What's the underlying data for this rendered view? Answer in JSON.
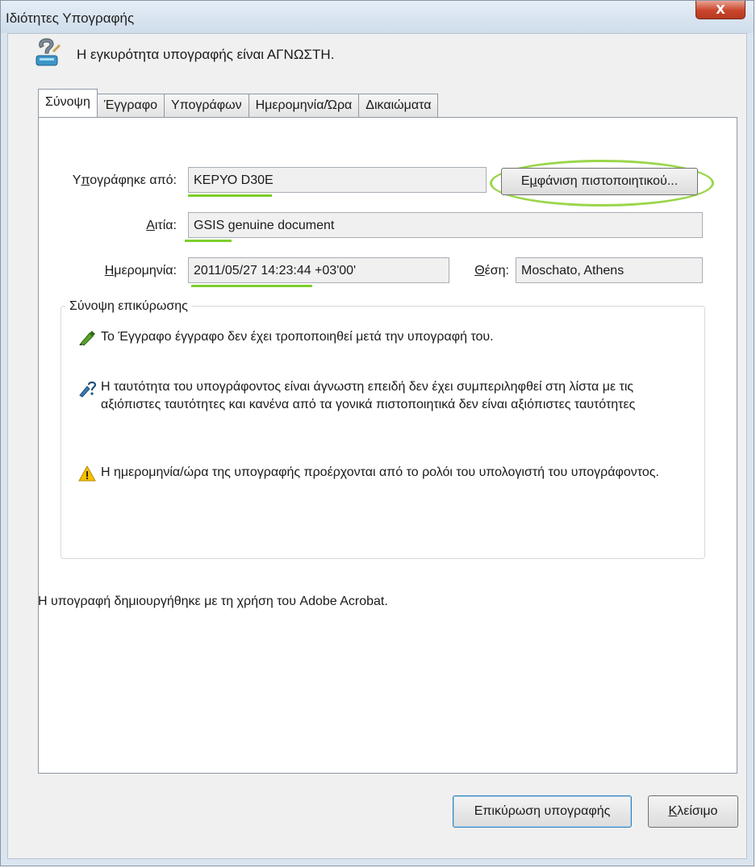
{
  "window": {
    "title": "Ιδιότητες Υπογραφής",
    "close_glyph": "X"
  },
  "status": {
    "text": "Η εγκυρότητα υπογραφής είναι ΑΓΝΩΣΤΗ.",
    "icon": "signature-unknown-icon"
  },
  "tabs": [
    {
      "label": "Σύνοψη",
      "active": true
    },
    {
      "label": "Έγγραφο",
      "active": false
    },
    {
      "label": "Υπογράφων",
      "active": false
    },
    {
      "label": "Ημερομηνία/Ώρα",
      "active": false
    },
    {
      "label": "Δικαιώματα",
      "active": false
    }
  ],
  "summary": {
    "signed_by": {
      "label_pre": "Υ",
      "label_mnemonic": "π",
      "label_post": "ογράφηκε από:",
      "value": "ΚΕΡΥΟ D30E"
    },
    "reason": {
      "label_mnemonic": "Α",
      "label_post": "ιτία:",
      "value": "GSIS genuine document"
    },
    "date": {
      "label_mnemonic": "Η",
      "label_post": "μερομηνία:",
      "value": "2011/05/27 14:23:44 +03'00'"
    },
    "location": {
      "label_mnemonic": "Θ",
      "label_post": "έση:",
      "value": "Moschato, Athens"
    },
    "show_certificate": {
      "pre": "Ε",
      "mnemonic": "μ",
      "post": "φάνιση πιστοποιητικού..."
    }
  },
  "validity": {
    "title": "Σύνοψη επικύρωσης",
    "items": [
      {
        "icon": "pen-valid-icon",
        "text": "Το Έγγραφο έγγραφο δεν έχει τροποποιηθεί μετά την υπογραφή του."
      },
      {
        "icon": "pen-unknown-icon",
        "text": "Η ταυτότητα του υπογράφοντος είναι άγνωστη επειδή δεν έχει συμπεριληφθεί στη λίστα με τις αξιόπιστες ταυτότητες και κανένα από τα γονικά πιστοποιητικά δεν είναι αξιόπιστες ταυτότητες"
      },
      {
        "icon": "warning-icon",
        "text": "Η ημερομηνία/ώρα της υπογραφής προέρχονται από το ρολόι του υπολογιστή του υπογράφοντος."
      }
    ]
  },
  "footer_note": "Η υπογραφή δημιουργήθηκε με τη χρήση του Adobe Acrobat.",
  "buttons": {
    "validate": "Επικύρωση υπογραφής",
    "close_mnemonic": "Κ",
    "close_post": "λείσιμο"
  },
  "colors": {
    "highlight_green": "#9ad64a",
    "warning_yellow": "#f5c000"
  }
}
